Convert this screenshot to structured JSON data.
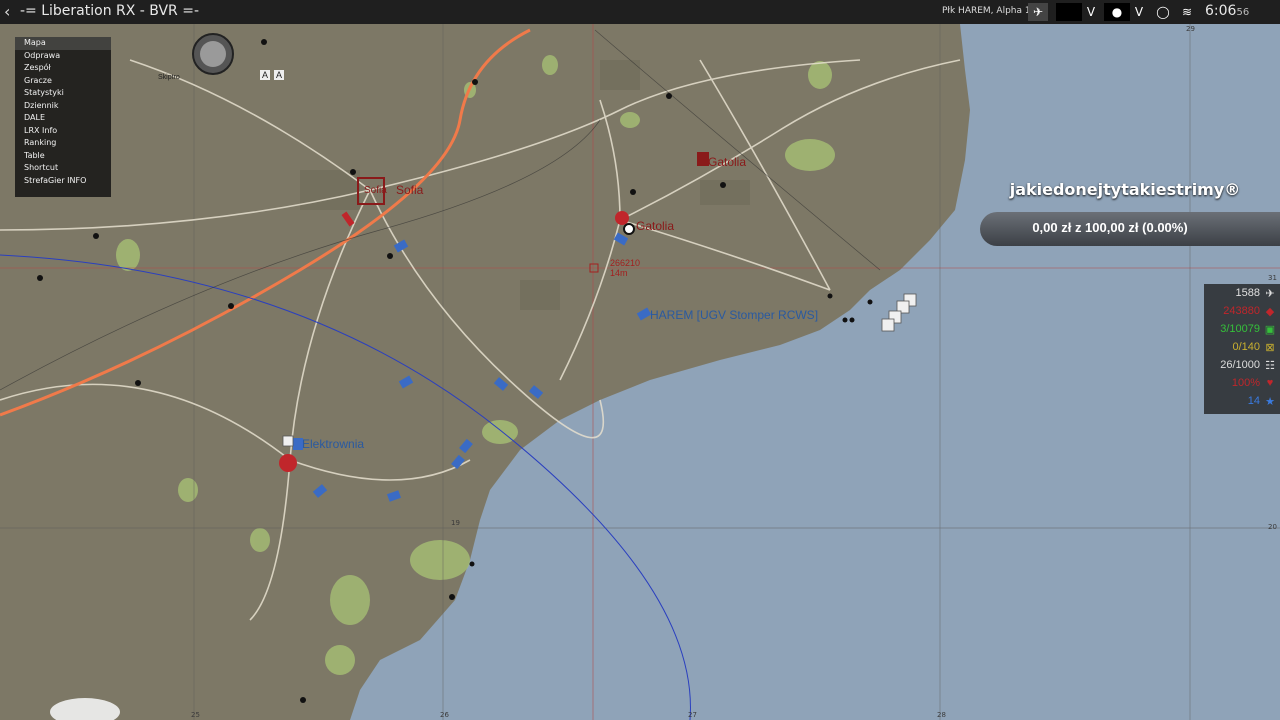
{
  "topbar": {
    "back_icon": "chevron-left",
    "title": "-= Liberation RX - BVR =-",
    "player": "Płk HAREM, Alpha 1-2 1",
    "clock_hm": "6:06",
    "clock_s": "56"
  },
  "menu": {
    "items": [
      "Mapa",
      "Odprawa",
      "Zespół",
      "Gracze",
      "Statystyki",
      "Dziennik",
      "DALE",
      "LRX Info",
      "Ranking",
      "Table",
      "Shortcut",
      "StrefaGier INFO"
    ],
    "selected": "Mapa"
  },
  "map": {
    "markers": {
      "sofia": "Sofia",
      "sofia_town": "Sofia",
      "gatolia": "Gatolia",
      "gatolia_2": "Gatolia",
      "elektrownia": "Elektrownia",
      "harem": "HAREM [UGV Stomper RCWS]",
      "waypoint_code": "266210",
      "waypoint_dist": "14m",
      "skiptro": "Skiptro",
      "icon_label_1": "A",
      "icon_label_2": "A"
    },
    "grid_labels": [
      "25",
      "26",
      "27",
      "28",
      "29",
      "31",
      "20",
      "19"
    ]
  },
  "donation": {
    "title": "jakiedonejtytakiestrimy®",
    "amount": "0,00 zł z 100,00 zł (0.00%)",
    "progress": 0.0
  },
  "stats": [
    {
      "value": "1588",
      "icon": "aircraft-icon",
      "color": "#e0e0e0"
    },
    {
      "value": "243880",
      "icon": "ammo-icon",
      "color": "#c0262b"
    },
    {
      "value": "3/10079",
      "icon": "fuel-icon",
      "color": "#35c03a"
    },
    {
      "value": "0/140",
      "icon": "intel-icon",
      "color": "#c9b02f"
    },
    {
      "value": "26/1000",
      "icon": "units-icon",
      "color": "#dddddd"
    },
    {
      "value": "100%",
      "icon": "civilian-icon",
      "color": "#c0262b"
    },
    {
      "value": "14",
      "icon": "star-icon",
      "color": "#3a7be0"
    }
  ],
  "colors": {
    "red_faction": "#8a1a1a",
    "blue_faction": "#2a5aa0",
    "road_highlight": "#f07a4a",
    "sea": "#8fa3b8",
    "land": "#7d7866"
  }
}
